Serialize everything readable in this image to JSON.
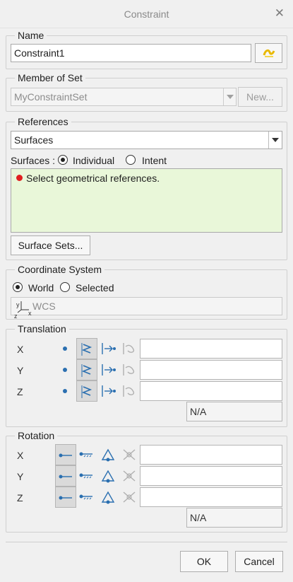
{
  "window": {
    "title": "Constraint",
    "close": "✕"
  },
  "name": {
    "legend": "Name",
    "value": "Constraint1"
  },
  "member": {
    "legend": "Member of Set",
    "value": "MyConstraintSet",
    "new_label": "New..."
  },
  "references": {
    "legend": "References",
    "type_value": "Surfaces",
    "surfaces_label": "Surfaces :",
    "individual_label": "Individual",
    "intent_label": "Intent",
    "message": "Select geometrical references.",
    "surface_sets_label": "Surface Sets..."
  },
  "coordinate_system": {
    "legend": "Coordinate System",
    "world_label": "World",
    "selected_label": "Selected",
    "value": "WCS",
    "icon_labels": {
      "y": "y",
      "z": "z",
      "x": "x"
    }
  },
  "translation": {
    "legend": "Translation",
    "rows": [
      {
        "axis": "X"
      },
      {
        "axis": "Y"
      },
      {
        "axis": "Z"
      }
    ],
    "summary": "N/A"
  },
  "rotation": {
    "legend": "Rotation",
    "rows": [
      {
        "axis": "X"
      },
      {
        "axis": "Y"
      },
      {
        "axis": "Z"
      }
    ],
    "summary": "N/A"
  },
  "footer": {
    "ok_label": "OK",
    "cancel_label": "Cancel"
  },
  "colors": {
    "message_bg": "#e9f7d9",
    "error_dot": "#e02020",
    "accent": "#2a6fb0"
  }
}
